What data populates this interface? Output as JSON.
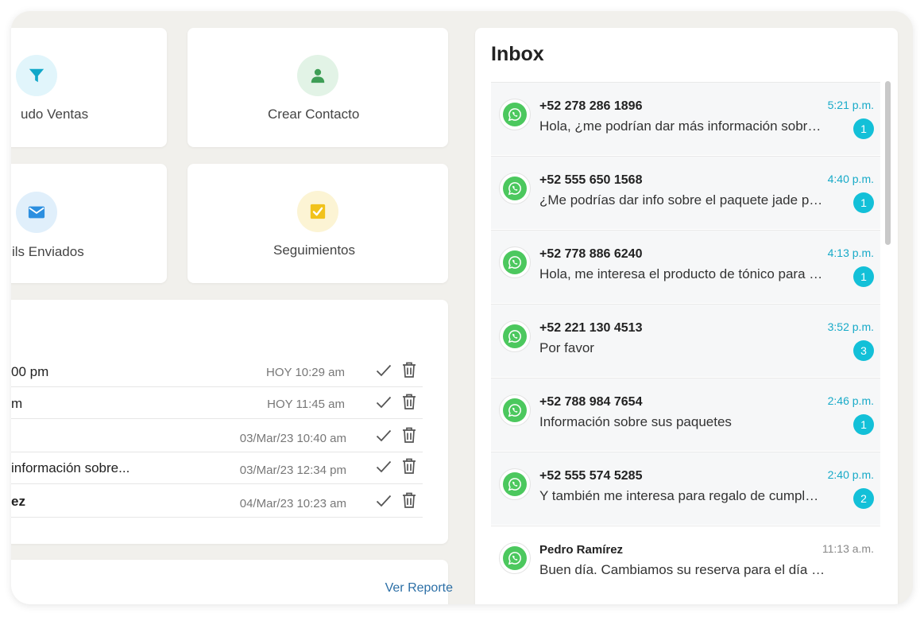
{
  "quick_actions": [
    {
      "label": "udo Ventas",
      "icon": "funnel-icon",
      "bg": "#e1f5fb",
      "color": "#10a7c9"
    },
    {
      "label": "Crear Contacto",
      "icon": "user-icon",
      "bg": "#e2f3e6",
      "color": "#3e9e56"
    },
    {
      "label": "ils Enviados",
      "icon": "envelope-icon",
      "bg": "#e0effb",
      "color": "#2c8fe0"
    },
    {
      "label": "Seguimientos",
      "icon": "checkbox-icon",
      "bg": "#fcf4d4",
      "color": "#f1c21b"
    }
  ],
  "tasks": [
    {
      "title": "00 pm",
      "date": "HOY 10:29 am",
      "bold": false
    },
    {
      "title": "m",
      "date": "HOY 11:45 am",
      "bold": false
    },
    {
      "title": "",
      "date": "03/Mar/23 10:40 am",
      "bold": false
    },
    {
      "title": " información sobre...",
      "date": "03/Mar/23 12:34 pm",
      "bold": false
    },
    {
      "title": "ez",
      "date": "04/Mar/23 10:23 am",
      "bold": true
    }
  ],
  "report": {
    "link_label": "Ver Reporte"
  },
  "inbox": {
    "title": "Inbox",
    "conversations": [
      {
        "name": "+52 278 286 1896",
        "message": "Hola, ¿me podrían dar más información sobre el paquete",
        "time": "5:21 p.m.",
        "unread": "1"
      },
      {
        "name": "+52 555 650 1568",
        "message": "¿Me podrías dar info sobre el paquete jade para dos personas",
        "time": "4:40 p.m.",
        "unread": "1"
      },
      {
        "name": "+52 778 886 6240",
        "message": "Hola, me interesa el producto de tónico para el cabello",
        "time": "4:13 p.m.",
        "unread": "1"
      },
      {
        "name": "+52 221 130 4513",
        "message": "Por favor",
        "time": "3:52 p.m.",
        "unread": "3"
      },
      {
        "name": "+52 788 984 7654",
        "message": "Información sobre sus paquetes",
        "time": "2:46 p.m.",
        "unread": "1"
      },
      {
        "name": "+52 555 574 5285",
        "message": "Y también me interesa para regalo de cumpleaños",
        "time": "2:40 p.m.",
        "unread": "2"
      },
      {
        "name": "Pedro Ramírez",
        "message": "Buen día. Cambiamos su reserva para el día de mañana",
        "time": "11:13 a.m.",
        "unread": null
      }
    ]
  },
  "colors": {
    "whatsapp": "#4cc85e",
    "badge": "#13c0d8",
    "time_accent": "#17aac8",
    "link": "#2c6fa6"
  }
}
